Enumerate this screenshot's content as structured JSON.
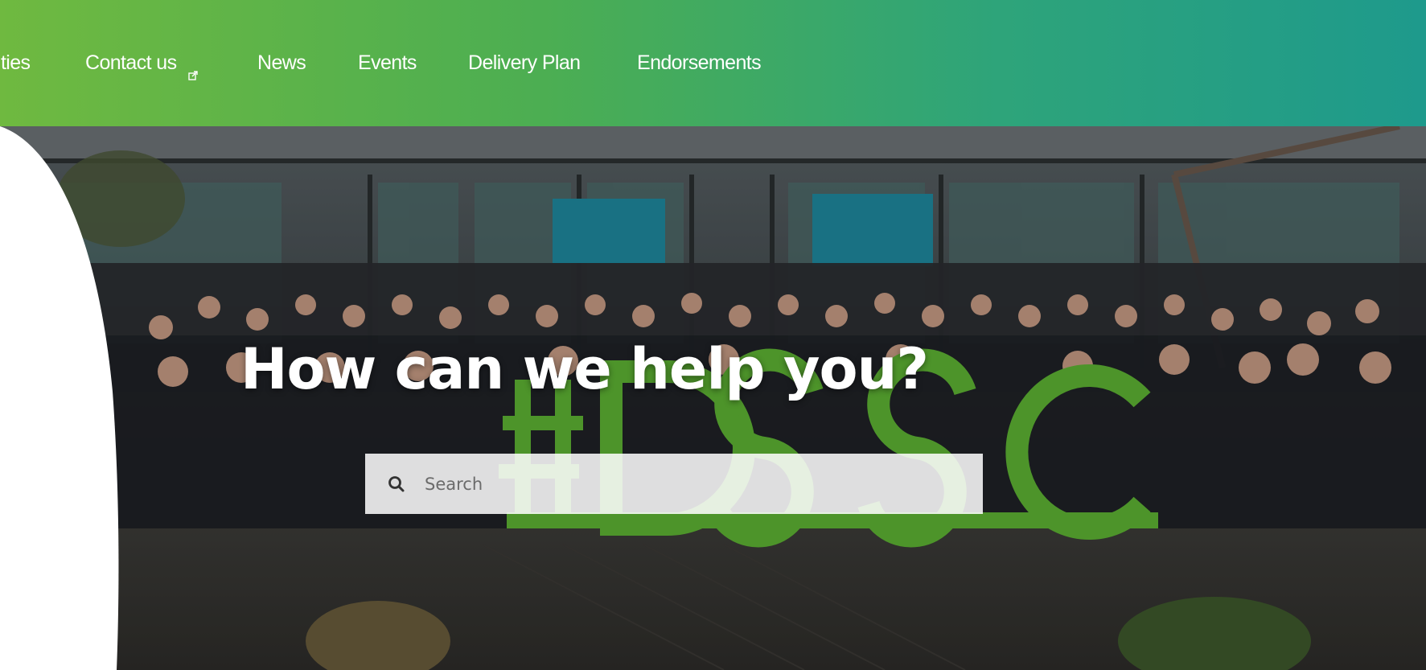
{
  "nav": {
    "items": [
      {
        "label": "ities"
      },
      {
        "label": "Contact us"
      },
      {
        "label": "News"
      },
      {
        "label": "Events"
      },
      {
        "label": "Delivery Plan"
      },
      {
        "label": "Endorsements"
      }
    ]
  },
  "hero": {
    "title": "How can we help you?",
    "photo_sign_text": "#DSSC",
    "search": {
      "placeholder": "Search",
      "value": ""
    }
  },
  "colors": {
    "nav_gradient_start": "#6fb940",
    "nav_gradient_end": "#1e9a8c",
    "sign_green": "#5fb534"
  },
  "icons": {
    "contact_external": "external-link-icon",
    "search": "search-icon"
  }
}
